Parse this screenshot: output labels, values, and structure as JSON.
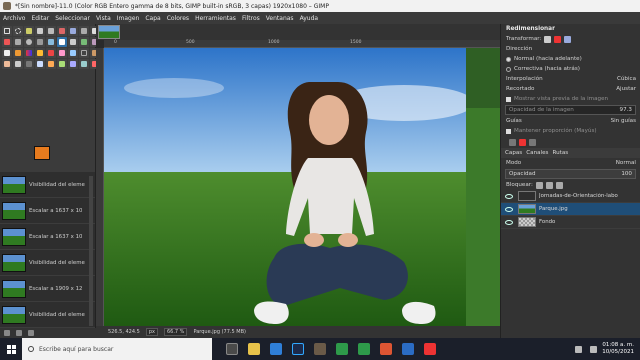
{
  "window": {
    "title": "*[Sin nombre]-11.0 (Color RGB Entero gamma de 8 bits, GIMP built-in sRGB, 3 capas) 1920x1080 – GIMP"
  },
  "menu": [
    "Archivo",
    "Editar",
    "Seleccionar",
    "Vista",
    "Imagen",
    "Capa",
    "Colores",
    "Herramientas",
    "Filtros",
    "Ventanas",
    "Ayuda"
  ],
  "colors": {
    "foreground": "#e77b1e",
    "background": "#e77b1e",
    "selection": "#1f4e78",
    "accent": "#2f6fa5"
  },
  "history": {
    "items": [
      {
        "label": "Visibilidad del eleme"
      },
      {
        "label": "Escalar a 1637 x 10"
      },
      {
        "label": "Escalar a 1637 x 10"
      },
      {
        "label": "Visibilidad del eleme"
      },
      {
        "label": "Escalar a 1909 x 12"
      },
      {
        "label": "Visibilidad del eleme"
      }
    ]
  },
  "ruler": {
    "ticks": [
      "0",
      "500",
      "1000",
      "1500"
    ]
  },
  "status": {
    "coords": "526.5, 424.5",
    "unit": "px",
    "zoom": "66.7 %",
    "info": "Parque.jpg (77.5 MB)"
  },
  "tool_options": {
    "title": "Redimensionar",
    "transform_label": "Transformar:",
    "direction_label": "Dirección",
    "direction_options": [
      {
        "label": "Normal (hacia adelante)",
        "selected": true
      },
      {
        "label": "Correctiva (hacia atrás)",
        "selected": false
      }
    ],
    "interpolation_label": "Interpolación",
    "interpolation_value": "Cúbica",
    "clipping_label": "Recortado",
    "clipping_value": "Ajustar",
    "preview_label": "Mostrar vista previa de la imagen",
    "opacity_label": "Opacidad de la imagen",
    "opacity_value": "97.3",
    "guides_label": "Guías",
    "guides_value": "Sin guías",
    "keep_ratio_label": "Mantener proporción (Mayús)"
  },
  "layers": {
    "tabs": [
      "Capas",
      "Canales",
      "Rutas"
    ],
    "mode_label": "Modo",
    "mode_value": "Normal",
    "opacity_label": "Opacidad",
    "opacity_value": "100",
    "lock_label": "Bloquear:",
    "items": [
      {
        "name": "Jornadas-de-Orientación-labo",
        "visible": true,
        "selected": false
      },
      {
        "name": "Parque.jpg",
        "visible": true,
        "selected": true
      },
      {
        "name": "Fondo",
        "visible": true,
        "selected": false
      }
    ]
  },
  "taskbar": {
    "search_placeholder": "Escribe aquí para buscar",
    "time": "01:08 a. m.",
    "date": "10/05/2021"
  }
}
